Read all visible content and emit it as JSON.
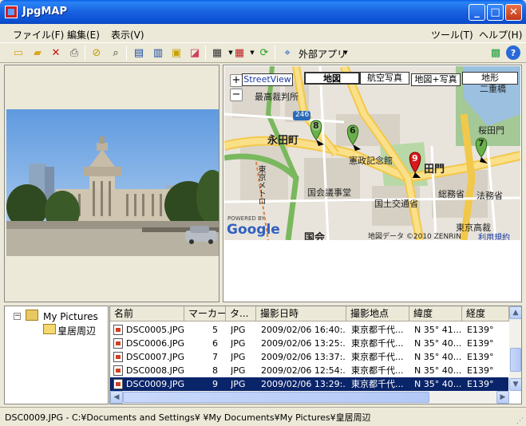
{
  "window": {
    "title": "JpgMAP"
  },
  "menu": {
    "file": "ファイル(F)",
    "edit": "編集(E)",
    "view": "表示(V)",
    "tools": "ツール(T)",
    "help": "ヘルプ(H)"
  },
  "toolbar": {
    "external_apps": "外部アプリ"
  },
  "map": {
    "streetview": "StreetView",
    "types": [
      "地図",
      "航空写真",
      "地図+写真",
      "地形"
    ],
    "labels": {
      "nagatacho": "永田町",
      "supreme_court": "最高裁判所",
      "diet": "国会議事堂",
      "constitution": "憲政記念館",
      "sakuradamon": "桜田門",
      "kasumigaseki": "田門",
      "mlit": "国土交通省",
      "mic": "総務省",
      "moj": "法務省",
      "kokkai": "国会",
      "nijubashi": "二重橋",
      "metro": "東京メトロ",
      "tokyo_hq": "東京高裁",
      "route": "246"
    },
    "markers": [
      "8",
      "6",
      "9",
      "7"
    ],
    "copyright": "地図データ ©2010 ZENRIN",
    "terms": "利用規約",
    "powered_by": "POWERED BY",
    "google": "Google"
  },
  "tree": {
    "root": "My Pictures",
    "child": "皇居周辺"
  },
  "list": {
    "columns": [
      "名前",
      "マーカー",
      "タ...",
      "撮影日時",
      "撮影地点",
      "緯度",
      "経度"
    ],
    "rows": [
      {
        "name": "DSC0005.JPG",
        "marker": "5",
        "type": "JPG",
        "date": "2009/02/06 16:40:...",
        "place": "東京都千代...",
        "lat": "N 35° 41...",
        "lng": "E139°"
      },
      {
        "name": "DSC0006.JPG",
        "marker": "6",
        "type": "JPG",
        "date": "2009/02/06 13:25:...",
        "place": "東京都千代...",
        "lat": "N 35° 40...",
        "lng": "E139°"
      },
      {
        "name": "DSC0007.JPG",
        "marker": "7",
        "type": "JPG",
        "date": "2009/02/06 13:37:...",
        "place": "東京都千代...",
        "lat": "N 35° 40...",
        "lng": "E139°"
      },
      {
        "name": "DSC0008.JPG",
        "marker": "8",
        "type": "JPG",
        "date": "2009/02/06 12:54:...",
        "place": "東京都千代...",
        "lat": "N 35° 40...",
        "lng": "E139°"
      },
      {
        "name": "DSC0009.JPG",
        "marker": "9",
        "type": "JPG",
        "date": "2009/02/06 13:29:...",
        "place": "東京都千代...",
        "lat": "N 35° 40...",
        "lng": "E139°"
      }
    ]
  },
  "status": {
    "text": "DSC0009.JPG - C:¥Documents and Settings¥          ¥My Documents¥My Pictures¥皇居周辺"
  },
  "colors": {
    "titlebar": "#0a5fe8",
    "selection": "#0a246a",
    "window_bg": "#ECE9D8"
  }
}
